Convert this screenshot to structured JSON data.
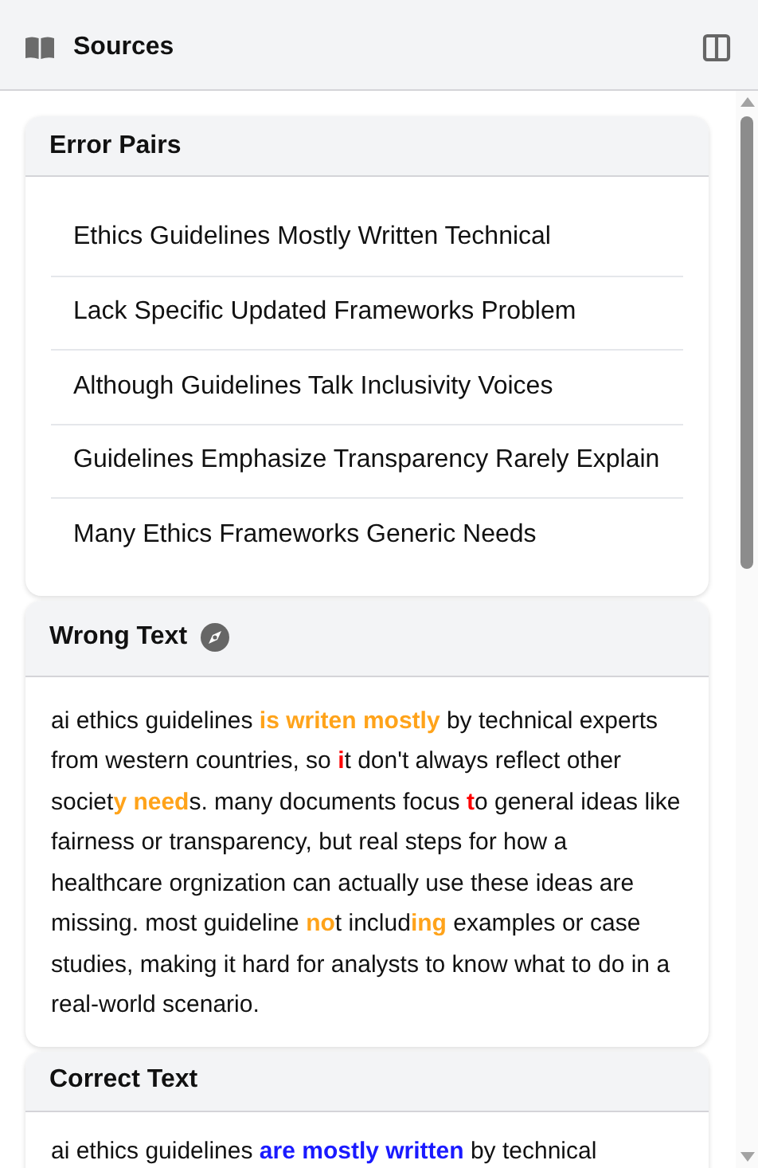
{
  "header": {
    "title": "Sources"
  },
  "error_pairs": {
    "title": "Error Pairs",
    "items": [
      "Ethics Guidelines Mostly Written Technical",
      "Lack Specific Updated Frameworks Problem",
      "Although Guidelines Talk Inclusivity Voices",
      "Guidelines Emphasize Transparency Rarely Explain",
      "Many Ethics Frameworks Generic Needs"
    ]
  },
  "wrong_text": {
    "title": "Wrong Text",
    "segments": [
      {
        "kind": "plain",
        "text": "ai ethics guidelines "
      },
      {
        "kind": "error",
        "text": "is writen mostly"
      },
      {
        "kind": "plain",
        "text": " by technical experts from western countries, so "
      },
      {
        "kind": "typo",
        "text": "i"
      },
      {
        "kind": "plain",
        "text": "t don't always reflect other societ"
      },
      {
        "kind": "error",
        "text": "y need"
      },
      {
        "kind": "plain",
        "text": "s. many documents focus "
      },
      {
        "kind": "typo",
        "text": "t"
      },
      {
        "kind": "plain",
        "text": "o general ideas like fairness or transparency, but real steps for how a healthcare orgnization can actually use these ideas are missing. most guideline "
      },
      {
        "kind": "error",
        "text": "no"
      },
      {
        "kind": "plain",
        "text": "t includ"
      },
      {
        "kind": "error",
        "text": "ing"
      },
      {
        "kind": "plain",
        "text": " examples or case studies, making it hard for analysts to know what to do in a real-world scenario."
      }
    ]
  },
  "correct_text": {
    "title": "Correct Text",
    "segments": [
      {
        "kind": "plain",
        "text": "ai ethics guidelines "
      },
      {
        "kind": "fix",
        "text": "are mostly written"
      },
      {
        "kind": "plain",
        "text": " by technical"
      }
    ]
  }
}
